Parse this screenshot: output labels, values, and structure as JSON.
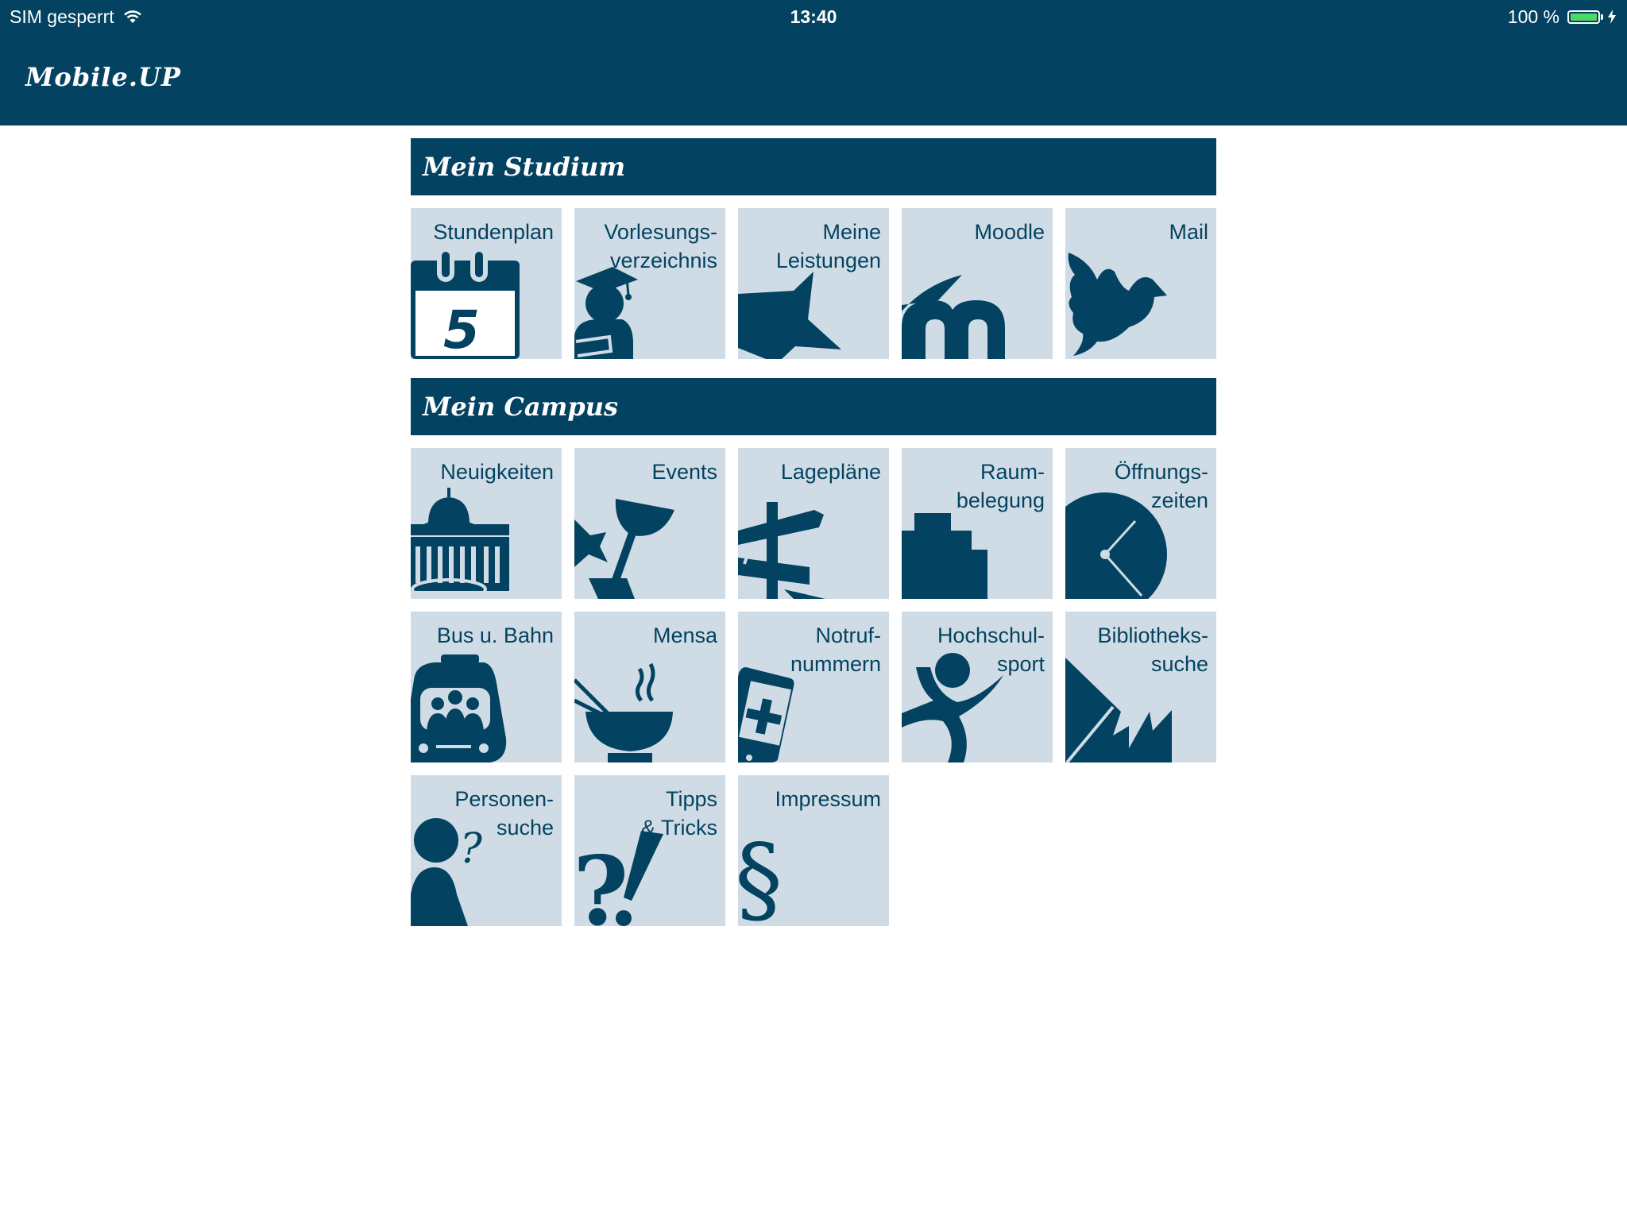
{
  "status_bar": {
    "carrier": "SIM gesperrt",
    "time": "13:40",
    "battery": "100 %",
    "battery_color": "#4cd964"
  },
  "app": {
    "title": "Mobile.UP",
    "brand_color": "#034361",
    "tile_color": "#d0dce5"
  },
  "sections": {
    "studium": {
      "title": "Mein Studium",
      "tiles": [
        {
          "label": "Stundenplan",
          "icon": "calendar-icon"
        },
        {
          "label": "Vorlesungs-\nverzeichnis",
          "icon": "graduate-icon"
        },
        {
          "label": "Meine\nLeistungen",
          "icon": "star-icon"
        },
        {
          "label": "Moodle",
          "icon": "moodle-icon"
        },
        {
          "label": "Mail",
          "icon": "bird-icon"
        }
      ]
    },
    "campus": {
      "title": "Mein Campus",
      "tiles": [
        {
          "label": "Neuigkeiten",
          "icon": "building-icon"
        },
        {
          "label": "Events",
          "icon": "cocktail-icon"
        },
        {
          "label": "Lagepläne",
          "icon": "signpost-icon"
        },
        {
          "label": "Raum-\nbelegung",
          "icon": "stairs-icon"
        },
        {
          "label": "Öffnungs-\nzeiten",
          "icon": "clock-icon"
        },
        {
          "label": "Bus u. Bahn",
          "icon": "tram-icon"
        },
        {
          "label": "Mensa",
          "icon": "bowl-icon"
        },
        {
          "label": "Notruf-\nnummern",
          "icon": "phone-emergency-icon"
        },
        {
          "label": "Hochschul-\nsport",
          "icon": "athlete-icon"
        },
        {
          "label": "Bibliotheks-\nsuche",
          "icon": "book-icon"
        },
        {
          "label": "Personen-\nsuche",
          "icon": "person-question-icon"
        },
        {
          "label": "Tipps\n& Tricks",
          "icon": "question-exclamation-icon"
        },
        {
          "label": "Impressum",
          "icon": "paragraph-icon"
        }
      ]
    }
  }
}
